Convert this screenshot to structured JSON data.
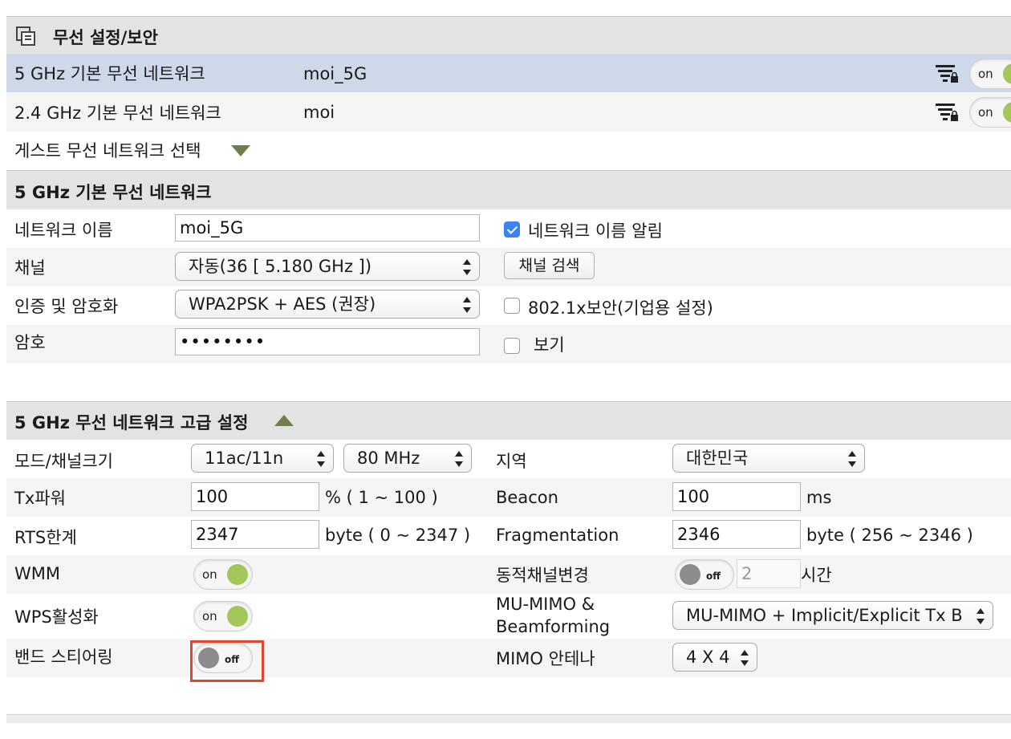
{
  "panel": {
    "title": "무선 설정/보안",
    "icon": "window-stack-icon"
  },
  "networks": [
    {
      "band": "5 GHz 기본 무선 네트워크",
      "ssid": "moi_5G",
      "toggle": "on",
      "filter_icon": "wifi-filter-lock-icon"
    },
    {
      "band": "2.4 GHz 기본 무선 네트워크",
      "ssid": "moi",
      "toggle": "on",
      "filter_icon": "wifi-filter-lock-icon"
    }
  ],
  "guest": {
    "label": "게스트 무선 네트워크 선택"
  },
  "basic": {
    "title": "5 GHz 기본 무선 네트워크",
    "name_label": "네트워크 이름",
    "name_value": "moi_5G",
    "broadcast_label": "네트워크 이름 알림",
    "broadcast_checked": true,
    "channel_label": "채널",
    "channel_value": "자동(36 [ 5.180 GHz ])",
    "scan_label": "채널 검색",
    "auth_label": "인증 및 암호화",
    "auth_value": "WPA2PSK + AES (권장)",
    "enterprise_label": "802.1x보안(기업용 설정)",
    "password_label": "암호",
    "password_value": "••••••••",
    "show_label": "보기"
  },
  "advanced": {
    "title": "5 GHz 무선 네트워크 고급 설정",
    "mode_label": "모드/채널크기",
    "mode_value": "11ac/11n",
    "width_value": "80 MHz",
    "region_label": "지역",
    "region_value": "대한민국",
    "tx_label": "Tx파워",
    "tx_value": "100",
    "tx_unit": "% ( 1 ~ 100 )",
    "beacon_label": "Beacon",
    "beacon_value": "100",
    "beacon_unit": "ms",
    "rts_label": "RTS한계",
    "rts_value": "2347",
    "rts_unit": "byte ( 0 ~ 2347 )",
    "frag_label": "Fragmentation",
    "frag_value": "2346",
    "frag_unit": "byte ( 256 ~ 2346 )",
    "wmm_label": "WMM",
    "wmm_toggle": "on",
    "dyn_label": "동적채널변경",
    "dyn_toggle": "off",
    "dyn_value": "2",
    "dyn_unit": "시간",
    "wps_label": "WPS활성화",
    "wps_toggle": "on",
    "mumimo_label_1": "MU-MIMO &",
    "mumimo_label_2": "Beamforming",
    "mumimo_value": "MU-MIMO + Implicit/Explicit Tx B",
    "steer_label": "밴드 스티어링",
    "steer_toggle": "off",
    "antenna_label": "MIMO 안테나",
    "antenna_value": "4 X 4"
  },
  "colors": {
    "highlight": "#e2452f",
    "toggle_on": "#a4c75b",
    "selected_row": "#cfd8e8",
    "accent_triangle": "#6f7f4a"
  }
}
